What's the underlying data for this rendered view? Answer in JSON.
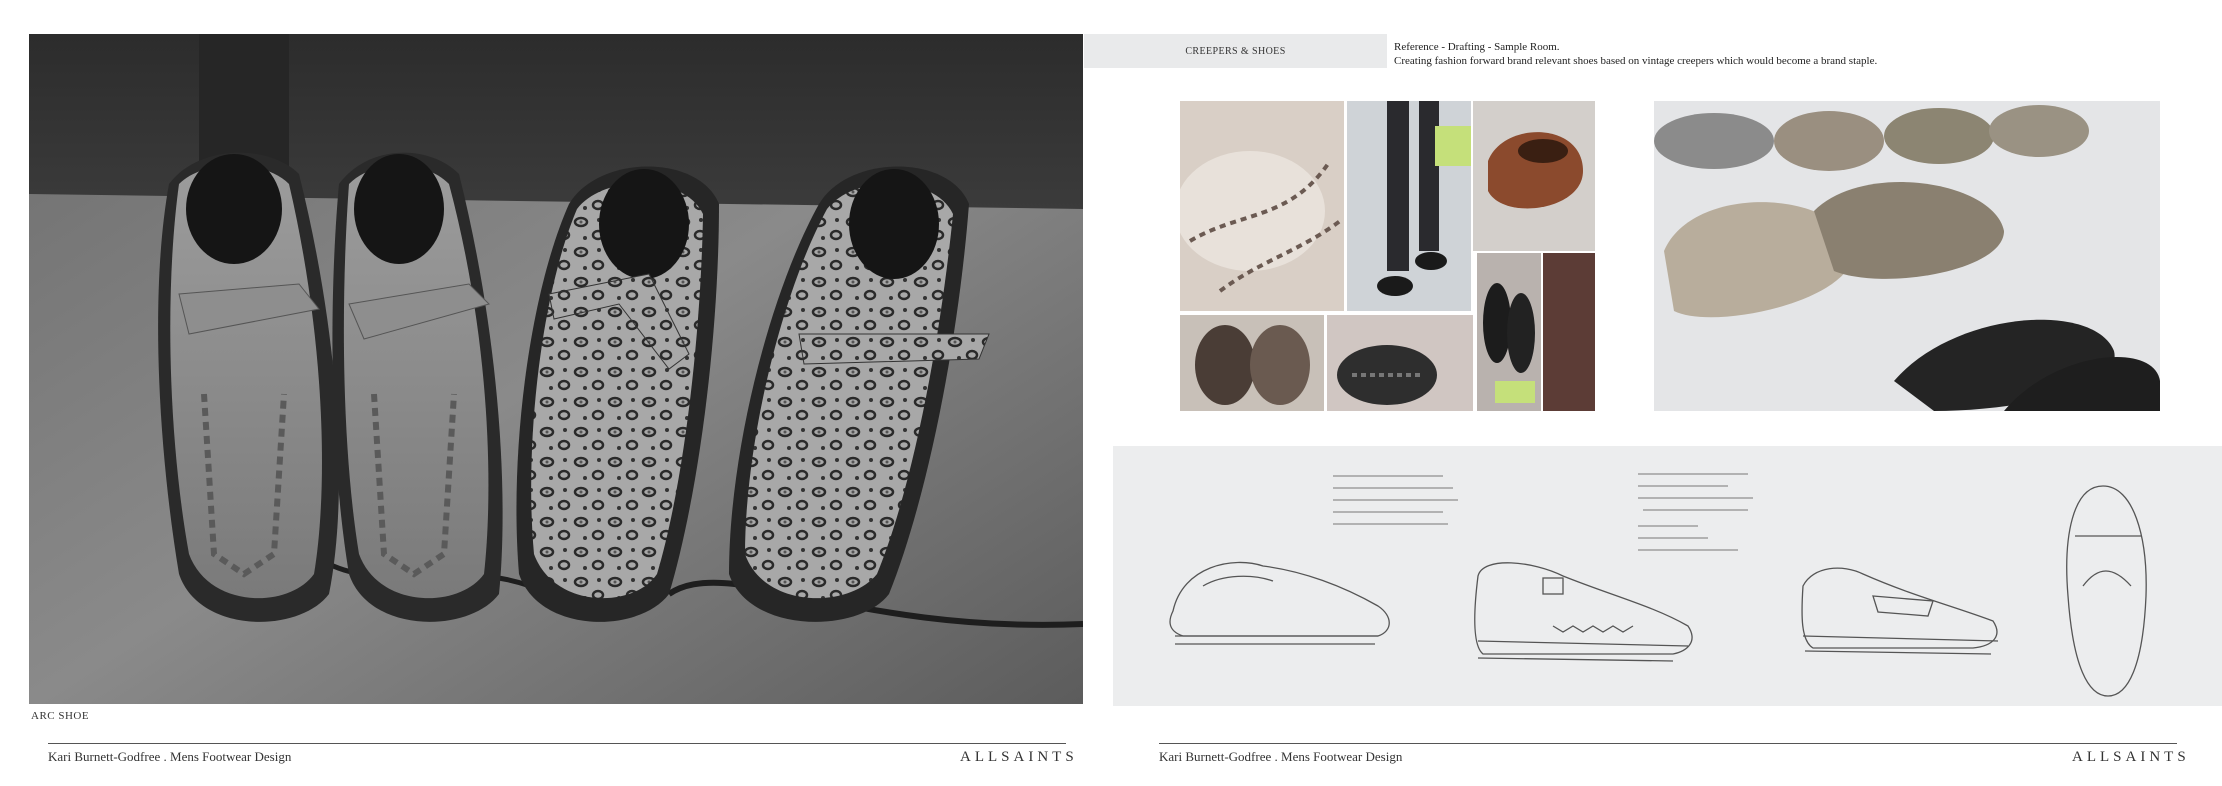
{
  "left_page": {
    "hero_image_alt": "Black and white photo of four creeper shoes, suede and leopard print with monk straps",
    "caption": "ARC SHOE",
    "footer": {
      "designer": "Kari Burnett-Godfree . Mens Footwear Design",
      "brand": "ALLSAINTS"
    }
  },
  "right_page": {
    "section_tag": "CREEPERS & SHOES",
    "reference": {
      "line1": "Reference - Drafting - Sample Room.",
      "line2": "Creating fashion forward brand relevant shoes based on vintage creepers which would become a brand staple."
    },
    "footer": {
      "designer": "Kari Burnett-Godfree . Mens Footwear Design",
      "brand": "ALLSAINTS"
    }
  }
}
